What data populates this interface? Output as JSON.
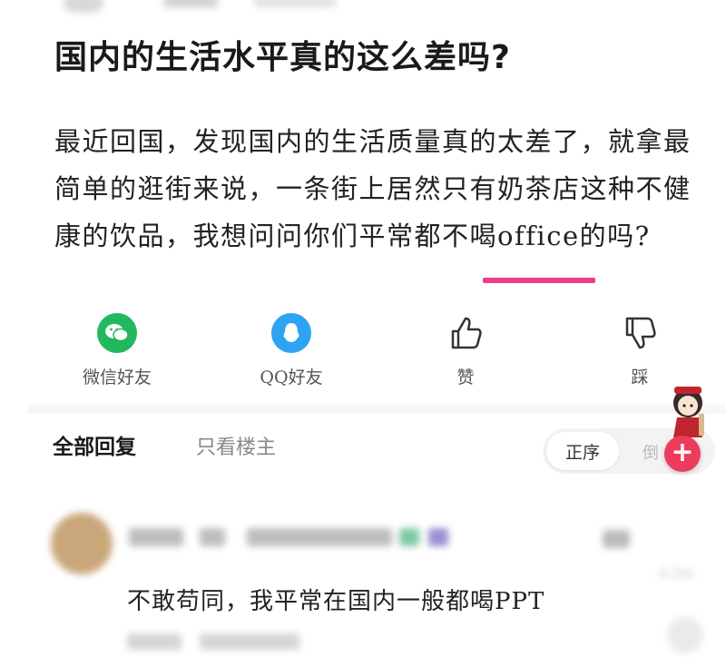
{
  "post": {
    "title": "国内的生活水平真的这么差吗?",
    "body_lines": [
      "最近回国，发现国内的生活质量真的太差了，就拿最",
      "简单的逛街来说，一条街上居然只有奶茶店这种不健",
      "康的饮品，我想问问你们平常都不喝office的吗?"
    ]
  },
  "share": {
    "wechat_label": "微信好友",
    "qq_label": "QQ好友",
    "like_label": "赞",
    "dislike_label": "踩"
  },
  "reply": {
    "tab_all": "全部回复",
    "tab_op": "只看楼主",
    "sort_selected": "正序",
    "sort_other": "倒"
  },
  "comment": {
    "text": "不敢苟同，我平常在国内一般都喝PPT",
    "like_count": "4.5w"
  },
  "colors": {
    "underline": "#e83e8c",
    "wechat": "#22b85e",
    "qq": "#2ea3f2",
    "fab": "#ee3a5b"
  }
}
